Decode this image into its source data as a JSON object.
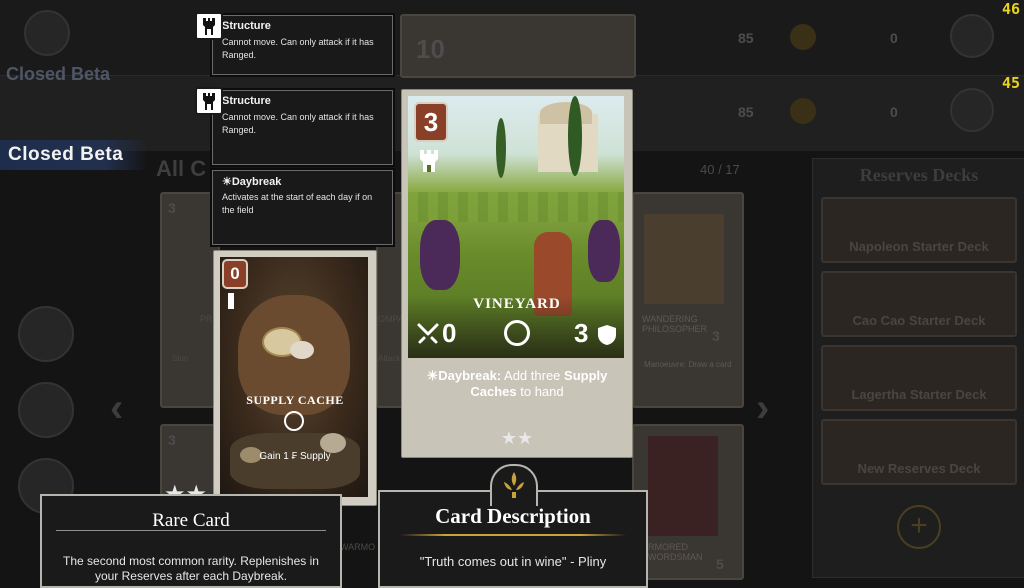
{
  "hud": {
    "fps_top": "46",
    "fps_second": "45"
  },
  "beta_label": "Closed Beta",
  "beta_ghost": "Closed Beta",
  "background": {
    "section_title_partial": "All C",
    "count_label": "40 / 17",
    "topbar_numbers": [
      "10",
      "85",
      "0"
    ],
    "reserves_title": "Reserves Decks",
    "reserves_decks": [
      "Napoleon Starter Deck",
      "Cao Cao Starter Deck",
      "Lagertha Starter Deck",
      "New Reserves Deck"
    ],
    "bg_card_left_cost": "3",
    "bg_card_left_cost2": "3",
    "bg_card_left_snip": "PR",
    "bg_card_left_text": "Stun",
    "bg_card_mid_snip": "OMPA",
    "bg_card_mid_text": "Attacks",
    "bg_card_right_name": "WANDERING PHILOSOPHER",
    "bg_card_right_text": "Manoeuvre: Draw a card",
    "bg_card_right_stat": "3",
    "bg_card_bottom_left": "WARMO",
    "bg_card_bottom_right": "ARMORED SWORDSMAN",
    "bg_card_bottom_right_stat": "5"
  },
  "tooltips": [
    {
      "title": "Structure",
      "desc": "Cannot move. Can only attack if it has Ranged."
    },
    {
      "title": "Structure",
      "desc": "Cannot move. Can only attack if it has Ranged."
    },
    {
      "title": "☀Daybreak",
      "desc": "Activates at the start of each day if on the field"
    }
  ],
  "supply_card": {
    "cost": "0",
    "name": "SUPPLY CACHE",
    "effect": "Gain 1 ₣ Supply"
  },
  "vineyard_card": {
    "cost": "3",
    "name": "VINEYARD",
    "attack": "0",
    "health": "3",
    "rule_prefix": "☀Daybreak:",
    "rule_text": " Add three ",
    "rule_bold1": "Supply",
    "rule_line2": "Caches",
    "rule_tail": " to hand",
    "stars": "★★"
  },
  "rarity_panel": {
    "stars": "★★",
    "title": "Rare Card",
    "body": "The second most common rarity. Replenishes in your Reserves after each Daybreak."
  },
  "description_panel": {
    "title": "Card Description",
    "quote": "\"Truth comes out in wine\" - Pliny"
  },
  "colors": {
    "accent_gold": "#c9a23a",
    "beta_blue": "#22304e",
    "fps_yellow": "#e9d21c",
    "cost_red": "#8a4028"
  }
}
